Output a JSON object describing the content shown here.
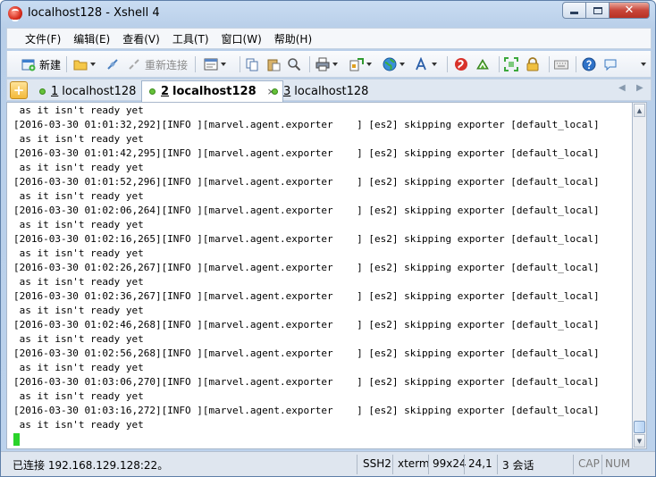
{
  "window": {
    "title": "localhost128 - Xshell 4",
    "icons": {
      "app": "xshell-app-icon",
      "minimize": "minimize-icon",
      "maximize": "maximize-icon",
      "close": "close-icon"
    }
  },
  "menu": {
    "items": [
      {
        "label": "文件(F)"
      },
      {
        "label": "编辑(E)"
      },
      {
        "label": "查看(V)"
      },
      {
        "label": "工具(T)"
      },
      {
        "label": "窗口(W)"
      },
      {
        "label": "帮助(H)"
      }
    ]
  },
  "toolbar": {
    "new_label": "新建",
    "reconnect_label": "重新连接"
  },
  "tabs": [
    {
      "num": "1",
      "label": "localhost128",
      "active": false
    },
    {
      "num": "2",
      "label": "localhost128",
      "active": true
    },
    {
      "num": "3",
      "label": "localhost128",
      "active": false
    }
  ],
  "terminal": {
    "lines": [
      " as it isn't ready yet",
      "[2016-03-30 01:01:32,292][INFO ][marvel.agent.exporter    ] [es2] skipping exporter [default_local]",
      " as it isn't ready yet",
      "[2016-03-30 01:01:42,295][INFO ][marvel.agent.exporter    ] [es2] skipping exporter [default_local]",
      " as it isn't ready yet",
      "[2016-03-30 01:01:52,296][INFO ][marvel.agent.exporter    ] [es2] skipping exporter [default_local]",
      " as it isn't ready yet",
      "[2016-03-30 01:02:06,264][INFO ][marvel.agent.exporter    ] [es2] skipping exporter [default_local]",
      " as it isn't ready yet",
      "[2016-03-30 01:02:16,265][INFO ][marvel.agent.exporter    ] [es2] skipping exporter [default_local]",
      " as it isn't ready yet",
      "[2016-03-30 01:02:26,267][INFO ][marvel.agent.exporter    ] [es2] skipping exporter [default_local]",
      " as it isn't ready yet",
      "[2016-03-30 01:02:36,267][INFO ][marvel.agent.exporter    ] [es2] skipping exporter [default_local]",
      " as it isn't ready yet",
      "[2016-03-30 01:02:46,268][INFO ][marvel.agent.exporter    ] [es2] skipping exporter [default_local]",
      " as it isn't ready yet",
      "[2016-03-30 01:02:56,268][INFO ][marvel.agent.exporter    ] [es2] skipping exporter [default_local]",
      " as it isn't ready yet",
      "[2016-03-30 01:03:06,270][INFO ][marvel.agent.exporter    ] [es2] skipping exporter [default_local]",
      " as it isn't ready yet",
      "[2016-03-30 01:03:16,272][INFO ][marvel.agent.exporter    ] [es2] skipping exporter [default_local]",
      " as it isn't ready yet"
    ],
    "cursor_color": "#2ad32a"
  },
  "status": {
    "connection": "已连接 192.168.129.128:22。",
    "protocol": "SSH2",
    "term": "xterm",
    "size": "99x24",
    "cursor_pos": "24,1",
    "sessions": "3 会话",
    "cap": "CAP",
    "num": "NUM"
  },
  "colors": {
    "accent": "#5e7fa8",
    "active_dot": "#66c23a"
  }
}
